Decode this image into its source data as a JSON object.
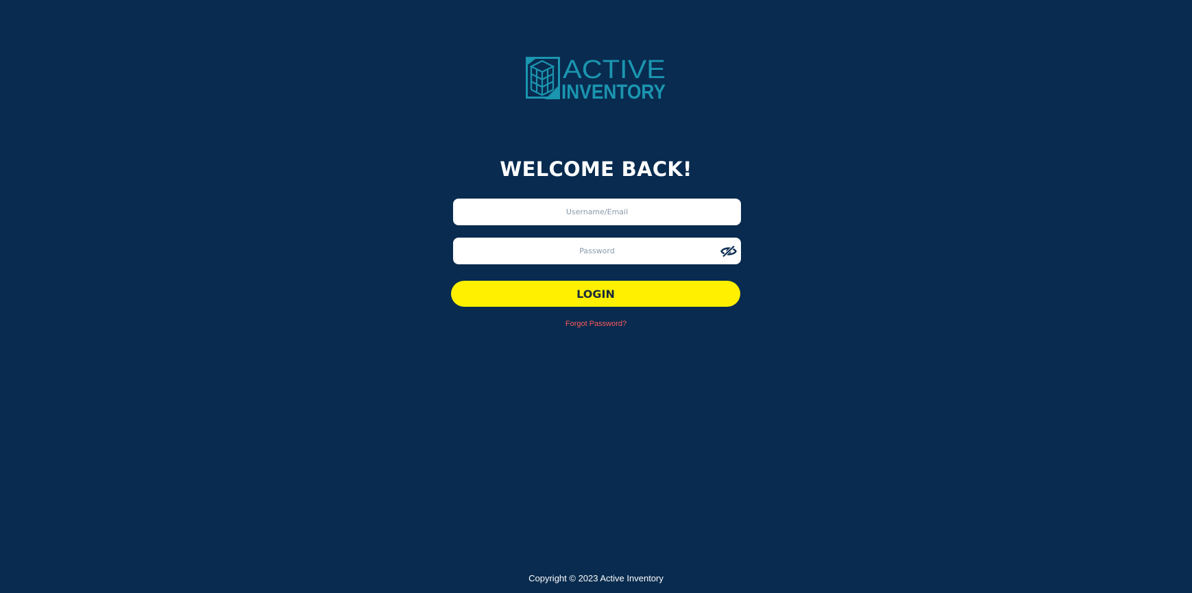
{
  "logo": {
    "line1": "ACTIVE",
    "line2": "INVENTORY",
    "color": "#1b95b0"
  },
  "heading": "WELCOME BACK!",
  "username": {
    "placeholder": "Username/Email",
    "value": ""
  },
  "password": {
    "placeholder": "Password",
    "value": ""
  },
  "password_toggle_icon": "eye-slash-icon",
  "login_label": "LOGIN",
  "forgot_password": "Forgot Password?",
  "footer": "Copyright © 2023 Active Inventory",
  "colors": {
    "background": "#082b4f",
    "accent": "#fff000",
    "link": "#ff5a5a",
    "logo": "#1b95b0"
  }
}
